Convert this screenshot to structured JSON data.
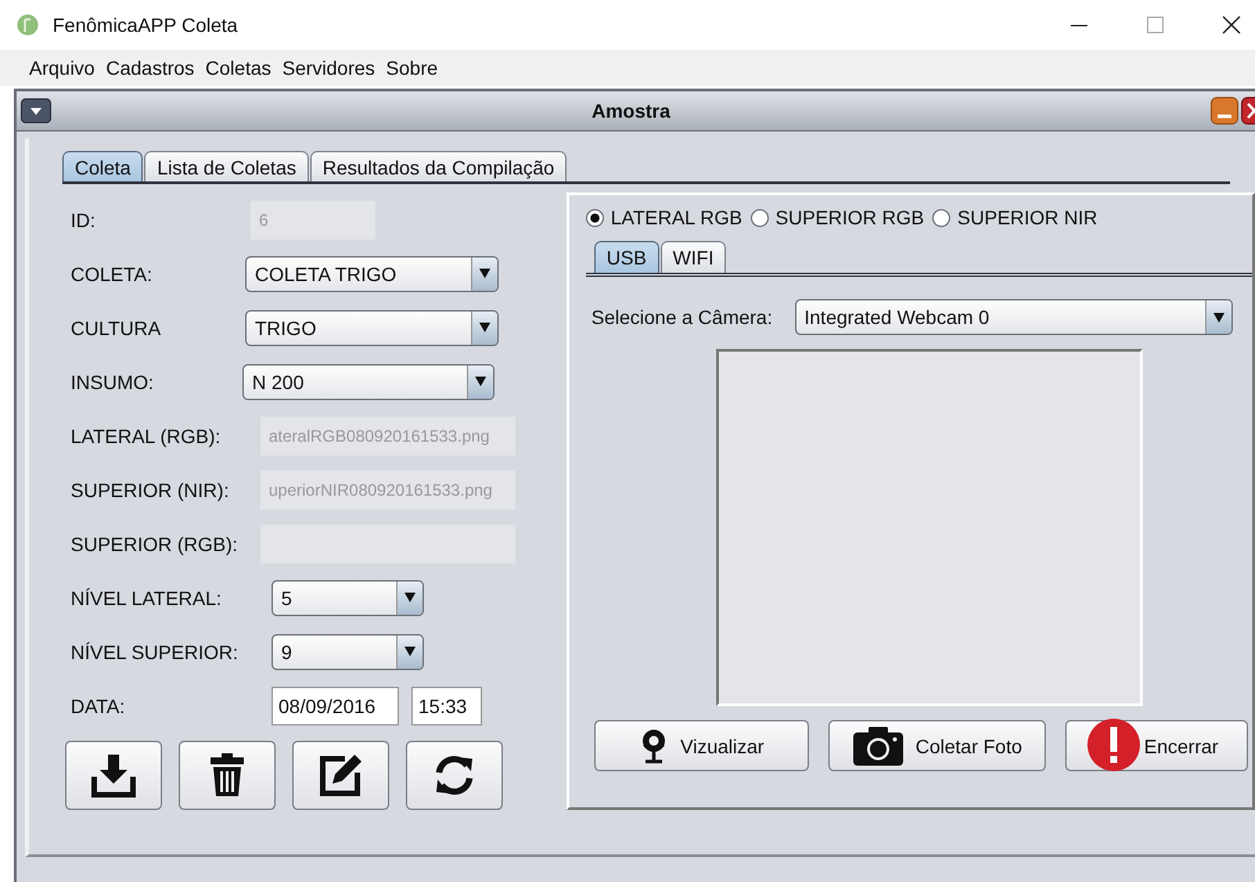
{
  "window": {
    "title": "FenômicaAPP Coleta"
  },
  "menu": [
    "Arquivo",
    "Cadastros",
    "Coletas",
    "Servidores",
    "Sobre"
  ],
  "internal_frame": {
    "title": "Amostra"
  },
  "tabs": [
    {
      "label": "Coleta",
      "selected": true
    },
    {
      "label": "Lista de Coletas",
      "selected": false
    },
    {
      "label": "Resultados da Compilação",
      "selected": false
    }
  ],
  "form": [
    {
      "label": "ID:",
      "kind": "text",
      "value": "6",
      "disabled": true
    },
    {
      "label": "COLETA:",
      "kind": "combo",
      "value": "COLETA TRIGO"
    },
    {
      "label": "CULTURA",
      "kind": "combo",
      "value": "TRIGO"
    },
    {
      "label": "INSUMO:",
      "kind": "combo",
      "value": "N 200"
    },
    {
      "label": "LATERAL (RGB):",
      "kind": "text",
      "value": "ateralRGB080920161533.png",
      "disabled": true
    },
    {
      "label": "SUPERIOR (NIR):",
      "kind": "text",
      "value": "uperiorNIR080920161533.png",
      "disabled": true
    },
    {
      "label": "SUPERIOR (RGB):",
      "kind": "text",
      "disabled": true
    },
    {
      "label": "NÍVEL LATERAL:",
      "kind": "combo",
      "value": "5"
    },
    {
      "label": "NÍVEL SUPERIOR:",
      "kind": "combo",
      "value": "9"
    },
    {
      "label": "DATA:",
      "kind": "datetime",
      "value": "08/09/2016",
      "time": "15:33"
    }
  ],
  "source_options": [
    {
      "label": "LATERAL RGB",
      "selected": true
    },
    {
      "label": "SUPERIOR RGB",
      "selected": false
    },
    {
      "label": "SUPERIOR NIR",
      "selected": false
    }
  ],
  "connection_tabs": [
    {
      "label": "USB",
      "selected": true
    },
    {
      "label": "WIFI",
      "selected": false
    }
  ],
  "camera": {
    "label": "Selecione a Câmera:",
    "value": "Integrated Webcam 0"
  },
  "buttons": [
    "Vizualizar",
    "Coletar Foto",
    "Encerrar"
  ]
}
